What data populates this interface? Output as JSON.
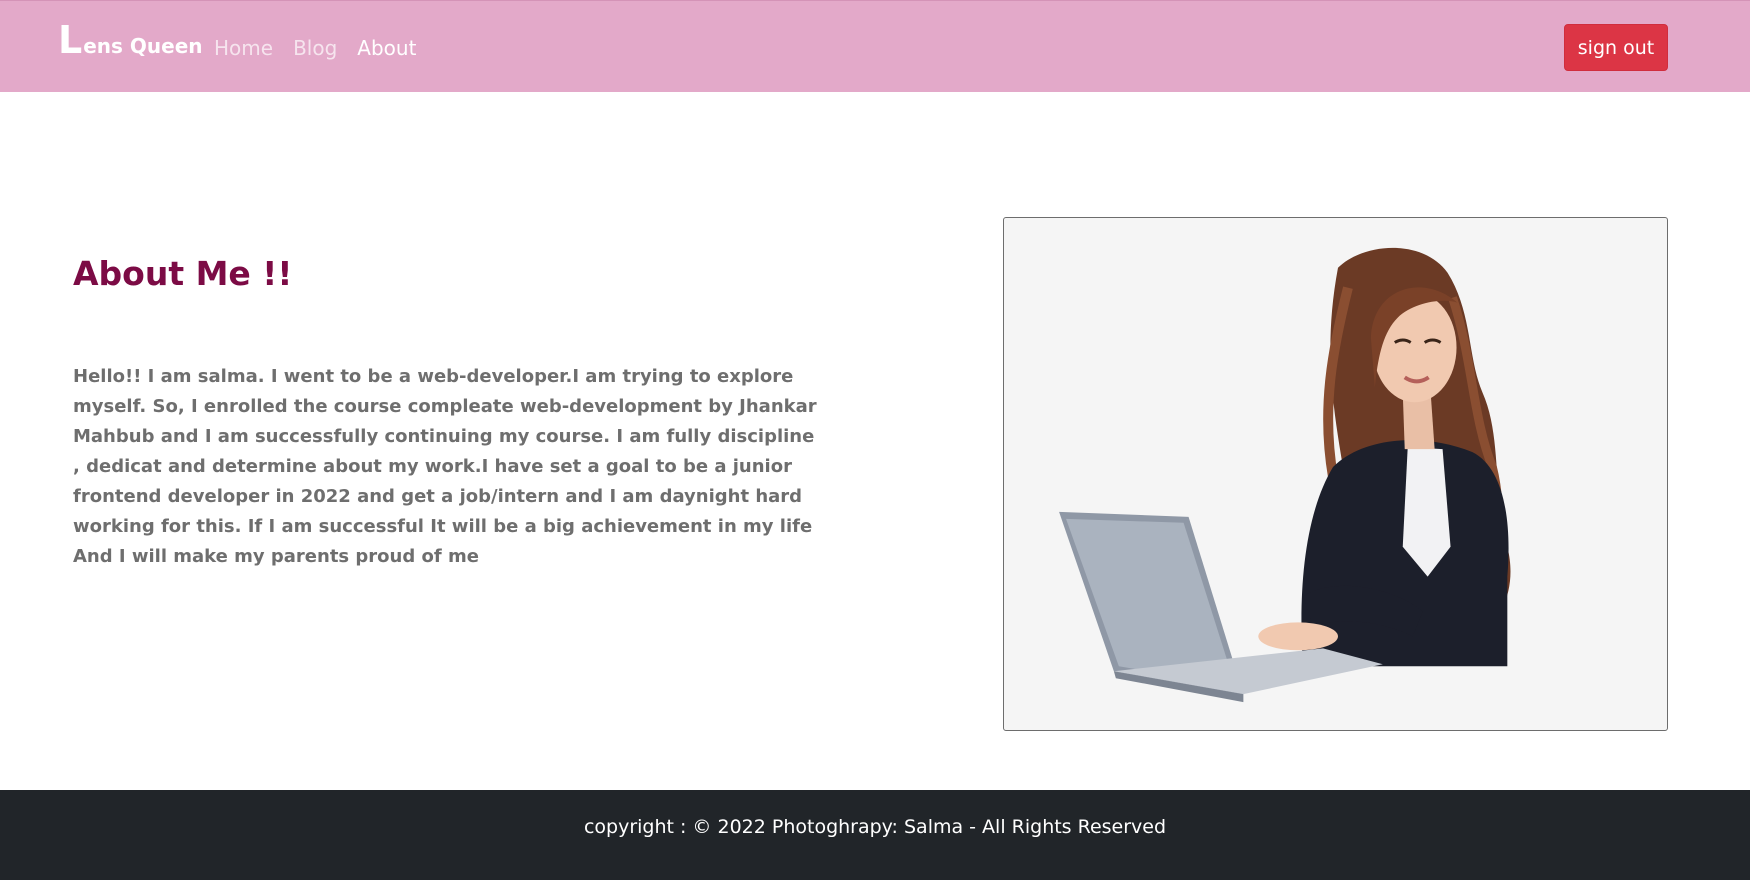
{
  "navbar": {
    "brand_first": "L",
    "brand_rest": "ens Queen",
    "links": [
      {
        "label": "Home"
      },
      {
        "label": "Blog"
      },
      {
        "label": "About"
      }
    ],
    "signout_label": "sign out"
  },
  "about": {
    "title": "About Me !!",
    "text": "Hello!! I am salma. I went to be a web-developer.I am trying to explore myself. So, I enrolled the course compleate web-development by Jhankar Mahbub and I am successfully continuing my course. I am fully discipline , dedicat and determine about my work.I have set a goal to be a junior frontend developer in 2022 and get a job/intern and I am daynight hard working for this. If I am successful It will be a big achievement in my life And I will make my parents proud of me"
  },
  "footer": {
    "text": "copyright : © 2022 Photoghrapy: Salma - All Rights Reserved"
  },
  "colors": {
    "navbar_bg": "#e3a9c9",
    "signout_bg": "#dc3545",
    "title_color": "#7c0b45",
    "footer_bg": "#212529"
  }
}
